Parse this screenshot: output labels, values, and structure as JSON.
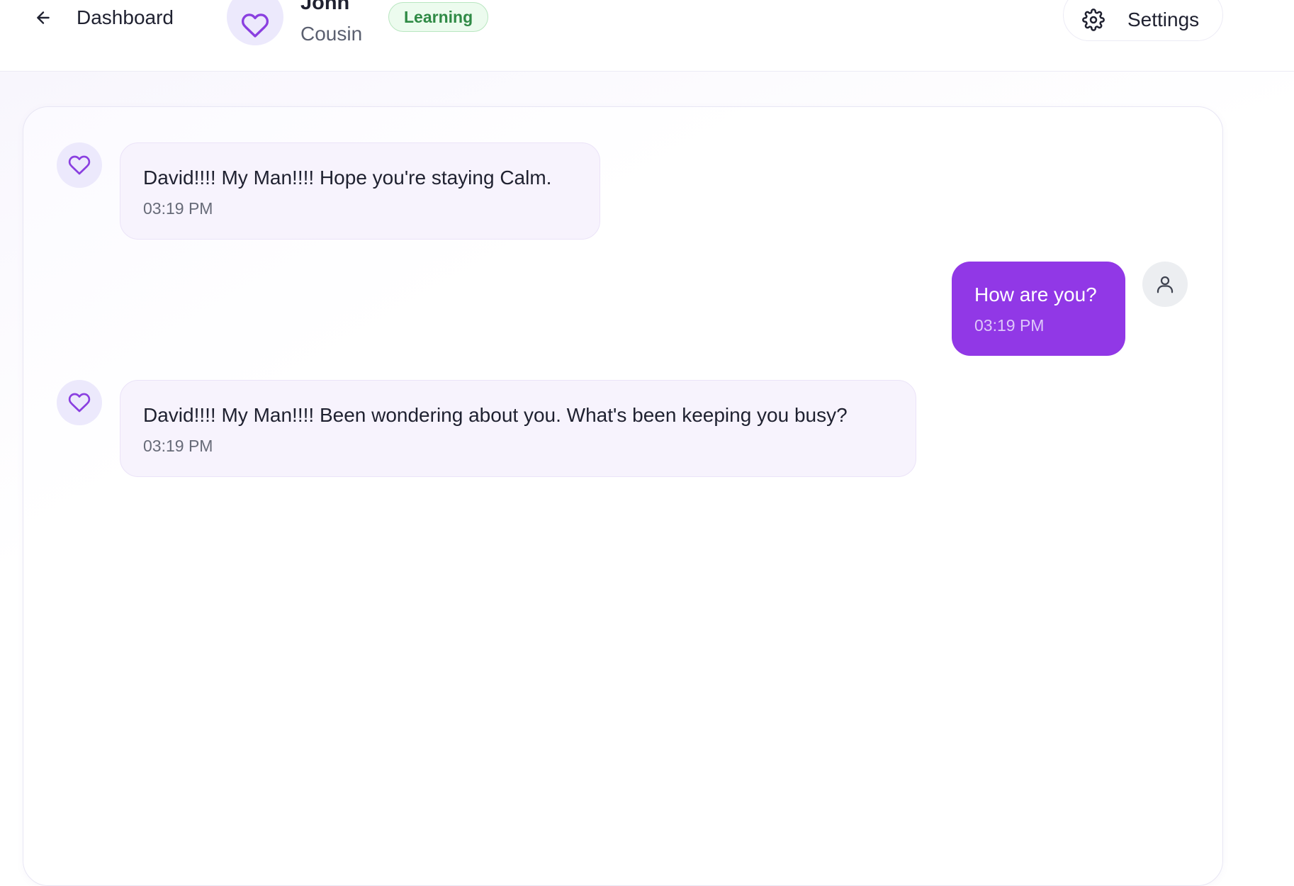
{
  "header": {
    "back_label": "Dashboard",
    "contact_name": "John",
    "contact_relation": "Cousin",
    "status_badge": "Learning",
    "settings_label": "Settings"
  },
  "messages": [
    {
      "sender": "contact",
      "text": "David!!!! My Man!!!! Hope you're staying Calm.",
      "time": "03:19 PM"
    },
    {
      "sender": "user",
      "text": "How are you?",
      "time": "03:19 PM"
    },
    {
      "sender": "contact",
      "text": "David!!!! My Man!!!! Been wondering about you. What's been keeping you busy?",
      "time": "03:19 PM"
    }
  ],
  "icons": {
    "back": "arrow-left-icon",
    "contact": "heart-icon",
    "settings": "gear-icon",
    "user": "user-icon"
  },
  "colors": {
    "accent": "#9138e6",
    "badge_text": "#2f8a45",
    "badge_bg": "#ecfbee",
    "incoming_bubble": "#f7f3fd"
  }
}
